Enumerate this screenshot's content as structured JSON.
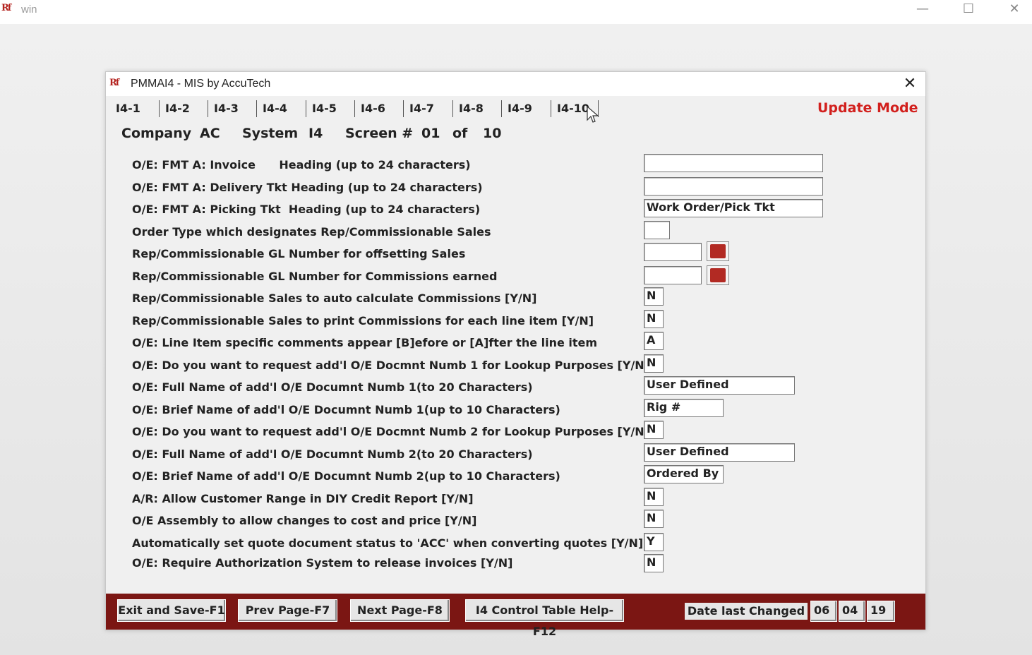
{
  "outer_window": {
    "title": "win",
    "minimize": "—",
    "maximize": "☐",
    "close": "✕"
  },
  "dialog": {
    "title": "PMMAI4 - MIS by AccuTech",
    "close": "✕",
    "mode": "Update Mode",
    "tabs": [
      "I4-1",
      "I4-2",
      "I4-3",
      "I4-4",
      "I4-5",
      "I4-6",
      "I4-7",
      "I4-8",
      "I4-9",
      "I4-10"
    ],
    "info": {
      "company_label": "Company",
      "company_value": "AC",
      "system_label": "System",
      "system_value": "I4",
      "screen_label": "Screen #",
      "screen_value": "01",
      "of_label": "of",
      "of_value": "10"
    },
    "rows": [
      {
        "label": "O/E: FMT A: Invoice      Heading (up to 24 characters)",
        "value": ""
      },
      {
        "label": "O/E: FMT A: Delivery Tkt Heading (up to 24 characters)",
        "value": ""
      },
      {
        "label": "O/E: FMT A: Picking Tkt  Heading (up to 24 characters)",
        "value": "Work Order/Pick Tkt"
      },
      {
        "label": "Order Type which designates Rep/Commissionable Sales",
        "value": ""
      },
      {
        "label": "Rep/Commissionable GL Number for offsetting Sales",
        "value": ""
      },
      {
        "label": "Rep/Commissionable GL Number for Commissions earned",
        "value": ""
      },
      {
        "label": "Rep/Commissionable Sales to auto calculate Commissions [Y/N]",
        "value": "N"
      },
      {
        "label": "Rep/Commissionable Sales to print Commissions for each line item [Y/N]",
        "value": "N"
      },
      {
        "label": "O/E: Line Item specific comments appear [B]efore or [A]fter the line item",
        "value": "A"
      },
      {
        "label": "O/E: Do you want to request add'l O/E Docmnt Numb 1 for Lookup Purposes [Y/N]",
        "value": "N"
      },
      {
        "label": "O/E: Full Name of add'l O/E Documnt Numb 1(to 20 Characters)",
        "value": "User Defined"
      },
      {
        "label": "O/E: Brief Name of add'l O/E Documnt Numb 1(up to 10 Characters)",
        "value": "Rig #"
      },
      {
        "label": "O/E: Do you want to request add'l O/E Docmnt Numb 2 for Lookup Purposes [Y/N]",
        "value": "N"
      },
      {
        "label": "O/E: Full Name of add'l O/E Documnt Numb 2(to 20 Characters)",
        "value": "User Defined"
      },
      {
        "label": "O/E: Brief Name of add'l O/E Documnt Numb 2(up to 10 Characters)",
        "value": "Ordered By"
      },
      {
        "label": "A/R: Allow Customer Range in DIY Credit Report [Y/N]",
        "value": "N"
      },
      {
        "label": "O/E Assembly to allow changes to cost and price [Y/N]",
        "value": "N"
      },
      {
        "label": "Automatically set quote document status to 'ACC' when converting quotes [Y/N]",
        "value": "Y"
      },
      {
        "label": "O/E: Require Authorization System to release invoices [Y/N]",
        "value": "N"
      }
    ],
    "footer": {
      "exit_save": "Exit and Save-F1",
      "prev_page": "Prev Page-F7",
      "next_page": "Next Page-F8",
      "help": "I4 Control Table Help-F12",
      "date_label": "Date last Changed",
      "date_month": "06",
      "date_day": "04",
      "date_year": "19"
    },
    "colors": {
      "accent_red": "#d2201d",
      "footer_bg": "#7b1613",
      "lookup_btn": "#b22a23"
    }
  }
}
